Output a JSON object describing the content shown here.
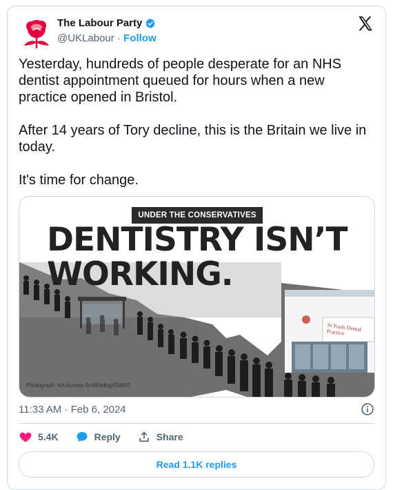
{
  "tweet": {
    "author_name": "The Labour Party",
    "handle": "@UKLabour",
    "separator": "·",
    "follow_label": "Follow",
    "paragraphs": [
      "Yesterday, hundreds of people desperate for an NHS dentist appointment queued for hours when a new practice opened in Bristol.",
      "After 14 years of Tory decline, this is the Britain we live in today.",
      "It's time for change."
    ],
    "timestamp": "11:33 AM · Feb 6, 2024"
  },
  "media": {
    "badge": "UNDER THE CONSERVATIVES",
    "headline_line1": "DENTISTRY ISN’T",
    "headline_line2": "WORKING.",
    "shop_sign": "St Pauls Dental Practice",
    "credit": "Photograph: AA Access Scaffolding/SWNS"
  },
  "actions": {
    "like_count": "5.4K",
    "reply_label": "Reply",
    "share_label": "Share"
  },
  "read_replies_label": "Read 1.1K replies",
  "colors": {
    "accent": "#1d9bf0",
    "like": "#f91880",
    "labour_red": "#e4003b",
    "text": "#0f1419",
    "muted": "#536471"
  },
  "icons": [
    "labour-rose-icon",
    "verified-badge-icon",
    "x-logo-icon",
    "info-icon",
    "heart-icon",
    "reply-bubble-icon",
    "share-icon"
  ]
}
